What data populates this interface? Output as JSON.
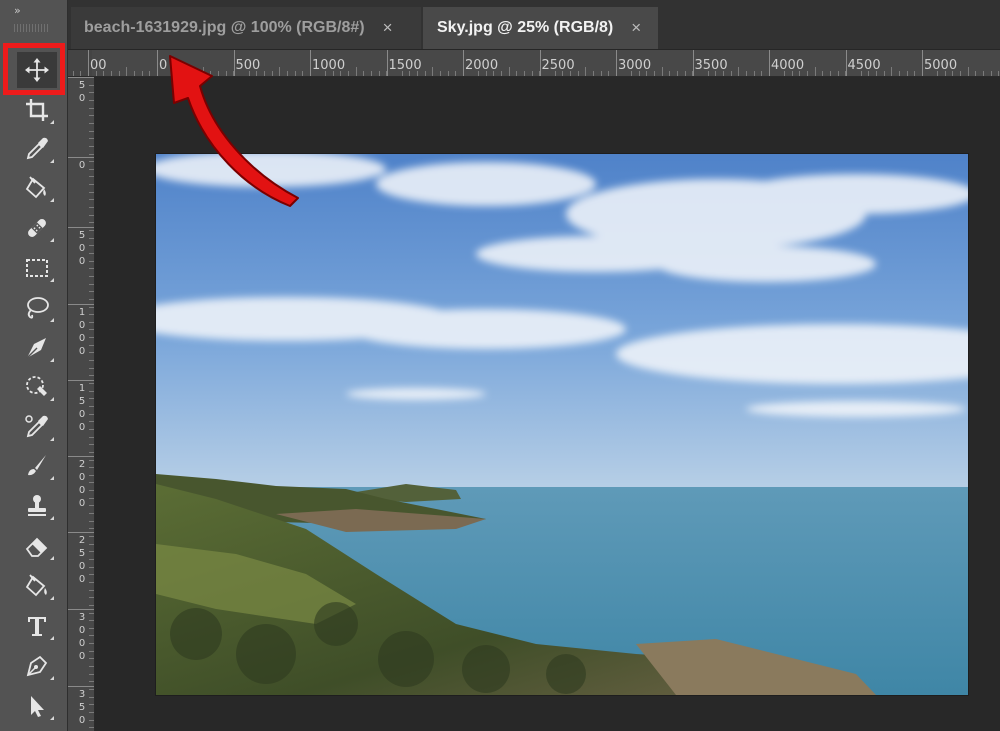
{
  "app": {
    "collapse_label": "»",
    "accent_highlight_color": "#ee1b1b"
  },
  "tabs": [
    {
      "label": "beach-1631929.jpg @ 100% (RGB/8#)",
      "close": "×",
      "active": false
    },
    {
      "label": "Sky.jpg @ 25% (RGB/8)",
      "close": "×",
      "active": true
    }
  ],
  "ruler": {
    "horizontal_labels": [
      "00",
      "0",
      "500",
      "1000",
      "1500",
      "2000",
      "2500",
      "3000",
      "3500",
      "4000",
      "4500",
      "5000"
    ],
    "vertical_labels": [
      "5\n0",
      "0",
      "5\n0\n0",
      "1\n0\n0\n0",
      "1\n5\n0\n0",
      "2\n0\n0\n0",
      "2\n5\n0\n0",
      "3\n0\n0\n0",
      "3\n5\n0"
    ]
  },
  "tools": [
    {
      "name": "move-tool",
      "icon": "move-icon",
      "active": true
    },
    {
      "name": "crop-tool",
      "icon": "crop-icon"
    },
    {
      "name": "eyedropper-tool",
      "icon": "eyedropper-icon"
    },
    {
      "name": "paint-bucket-tool",
      "icon": "paint-bucket-icon"
    },
    {
      "name": "healing-brush-tool",
      "icon": "bandage-icon"
    },
    {
      "name": "marquee-tool",
      "icon": "marquee-icon"
    },
    {
      "name": "lasso-tool",
      "icon": "lasso-icon"
    },
    {
      "name": "pen-nib-tool",
      "icon": "nib-icon"
    },
    {
      "name": "quick-selection-tool",
      "icon": "quick-selection-icon"
    },
    {
      "name": "color-sampler-tool",
      "icon": "color-sampler-icon"
    },
    {
      "name": "brush-tool",
      "icon": "brush-icon"
    },
    {
      "name": "clone-stamp-tool",
      "icon": "stamp-icon"
    },
    {
      "name": "eraser-tool",
      "icon": "eraser-icon"
    },
    {
      "name": "fill-tool",
      "icon": "bucket-icon"
    },
    {
      "name": "type-tool",
      "icon": "type-icon"
    },
    {
      "name": "pen-tool",
      "icon": "pen-icon"
    },
    {
      "name": "path-selection-tool",
      "icon": "arrow-cursor-icon"
    }
  ],
  "canvas": {
    "image_description_colors": {
      "sky": "#5f8fcf",
      "sea": "#4a8aa8",
      "land": "#4d5e2f"
    }
  }
}
